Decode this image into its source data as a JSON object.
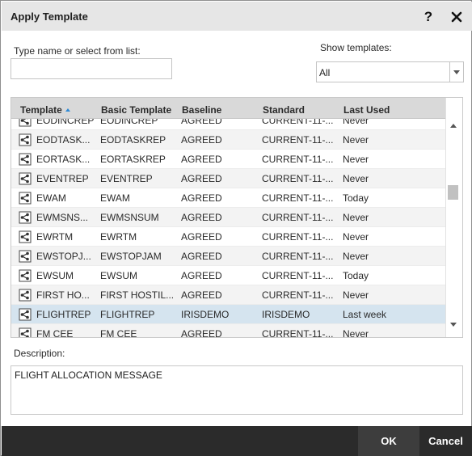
{
  "dialog": {
    "title": "Apply Template",
    "help_label": "?",
    "close_icon": "close-icon"
  },
  "search": {
    "label": "Type name or select from list:",
    "value": "",
    "placeholder": ""
  },
  "filter": {
    "label": "Show templates:",
    "selected": "All"
  },
  "grid": {
    "columns": [
      "Template",
      "Basic Template",
      "Baseline",
      "Standard",
      "Last Used"
    ],
    "sorted_column": "Template",
    "sort_direction": "ascending",
    "row_icon": "share-icon",
    "selected_row": "FLIGHTREP",
    "rows": [
      {
        "template": "EODINCREP",
        "basic": "EODINCREP",
        "baseline": "AGREED",
        "standard": "CURRENT-11-...",
        "last_used": "Never"
      },
      {
        "template": "EODTASK...",
        "basic": "EODTASKREP",
        "baseline": "AGREED",
        "standard": "CURRENT-11-...",
        "last_used": "Never"
      },
      {
        "template": "EORTASK...",
        "basic": "EORTASKREP",
        "baseline": "AGREED",
        "standard": "CURRENT-11-...",
        "last_used": "Never"
      },
      {
        "template": "EVENTREP",
        "basic": "EVENTREP",
        "baseline": "AGREED",
        "standard": "CURRENT-11-...",
        "last_used": "Never"
      },
      {
        "template": "EWAM",
        "basic": "EWAM",
        "baseline": "AGREED",
        "standard": "CURRENT-11-...",
        "last_used": "Today"
      },
      {
        "template": "EWMSNS...",
        "basic": "EWMSNSUM",
        "baseline": "AGREED",
        "standard": "CURRENT-11-...",
        "last_used": "Never"
      },
      {
        "template": "EWRTM",
        "basic": "EWRTM",
        "baseline": "AGREED",
        "standard": "CURRENT-11-...",
        "last_used": "Never"
      },
      {
        "template": "EWSTOPJ...",
        "basic": "EWSTOPJAM",
        "baseline": "AGREED",
        "standard": "CURRENT-11-...",
        "last_used": "Never"
      },
      {
        "template": "EWSUM",
        "basic": "EWSUM",
        "baseline": "AGREED",
        "standard": "CURRENT-11-...",
        "last_used": "Today"
      },
      {
        "template": "FIRST HO...",
        "basic": "FIRST HOSTIL...",
        "baseline": "AGREED",
        "standard": "CURRENT-11-...",
        "last_used": "Never"
      },
      {
        "template": "FLIGHTREP",
        "basic": "FLIGHTREP",
        "baseline": "IRISDEMO",
        "standard": "IRISDEMO",
        "last_used": "Last week"
      },
      {
        "template": "FM CEE",
        "basic": "FM CEE",
        "baseline": "AGREED",
        "standard": "CURRENT-11-...",
        "last_used": "Never"
      }
    ]
  },
  "description": {
    "label": "Description:",
    "value": "FLIGHT ALLOCATION MESSAGE"
  },
  "footer": {
    "ok_label": "OK",
    "cancel_label": "Cancel"
  },
  "colors": {
    "titlebar": "#e6e6e6",
    "header": "#d9d9d9",
    "selected_row": "#d5e4ef",
    "footer": "#2b2b2b",
    "sort_arrow": "#2d89d6"
  }
}
